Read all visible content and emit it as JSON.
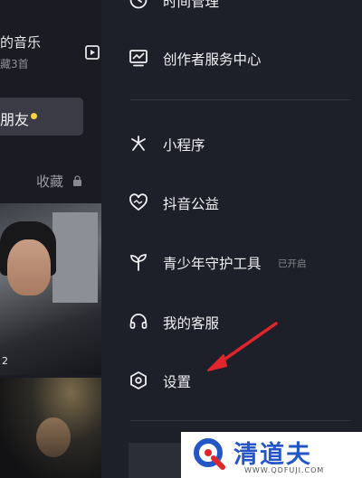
{
  "left_panel": {
    "music_title": "的音乐",
    "music_subtitle": "藏3首",
    "friend_button_label": "朋友",
    "collect_label": "收藏",
    "thumb_count": "2"
  },
  "drawer": {
    "top_partial_label": "时间管理",
    "items": [
      {
        "label": "创作者服务中心",
        "icon": "chart-monitor-icon"
      },
      {
        "label": "小程序",
        "icon": "mini-program-icon"
      },
      {
        "label": "抖音公益",
        "icon": "heart-charity-icon"
      },
      {
        "label": "青少年守护工具",
        "icon": "sprout-icon",
        "badge": "已开启"
      },
      {
        "label": "我的客服",
        "icon": "headset-icon"
      },
      {
        "label": "设置",
        "icon": "hexagon-gear-icon"
      }
    ]
  },
  "watermark": {
    "title": "清道夫",
    "url": "WWW.QDFUJI.COM"
  },
  "colors": {
    "background": "#1e2029",
    "accent_dot": "#f6d43b",
    "arrow": "#e0262c",
    "watermark_text": "#2456c8"
  }
}
